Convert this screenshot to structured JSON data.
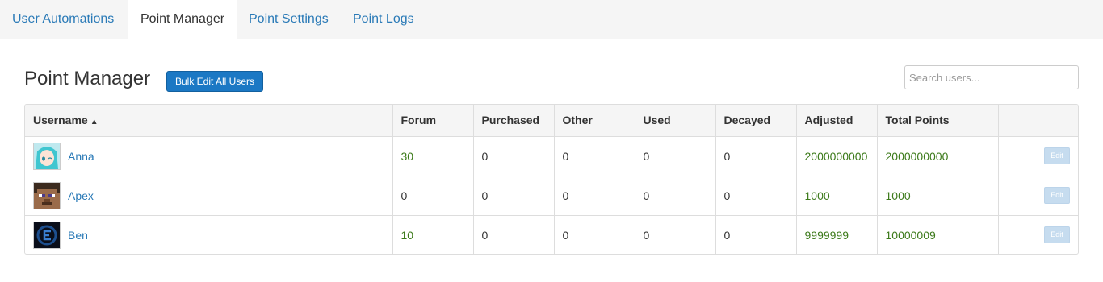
{
  "tabs": [
    {
      "label": "User Automations",
      "active": false
    },
    {
      "label": "Point Manager",
      "active": true
    },
    {
      "label": "Point Settings",
      "active": false
    },
    {
      "label": "Point Logs",
      "active": false
    }
  ],
  "page_title": "Point Manager",
  "bulk_edit_label": "Bulk Edit All Users",
  "search": {
    "placeholder": "Search users...",
    "value": ""
  },
  "table": {
    "columns": [
      "Username",
      "Forum",
      "Purchased",
      "Other",
      "Used",
      "Decayed",
      "Adjusted",
      "Total Points",
      ""
    ],
    "sort_column": "Username",
    "sort_direction": "ascending",
    "rows": [
      {
        "username": "Anna",
        "avatar": "anime-girl-avatar",
        "forum": "30",
        "purchased": "0",
        "other": "0",
        "used": "0",
        "decayed": "0",
        "adjusted": "2000000000",
        "total": "2000000000",
        "edit_label": "Edit"
      },
      {
        "username": "Apex",
        "avatar": "blocky-face-avatar",
        "forum": "0",
        "purchased": "0",
        "other": "0",
        "used": "0",
        "decayed": "0",
        "adjusted": "1000",
        "total": "1000",
        "edit_label": "Edit"
      },
      {
        "username": "Ben",
        "avatar": "dark-logo-avatar",
        "forum": "10",
        "purchased": "0",
        "other": "0",
        "used": "0",
        "decayed": "0",
        "adjusted": "9999999",
        "total": "10000009",
        "edit_label": "Edit"
      }
    ]
  },
  "colors": {
    "link": "#2a7ab7",
    "positive": "#3c7a1a",
    "primary_button": "#1b78c4"
  }
}
